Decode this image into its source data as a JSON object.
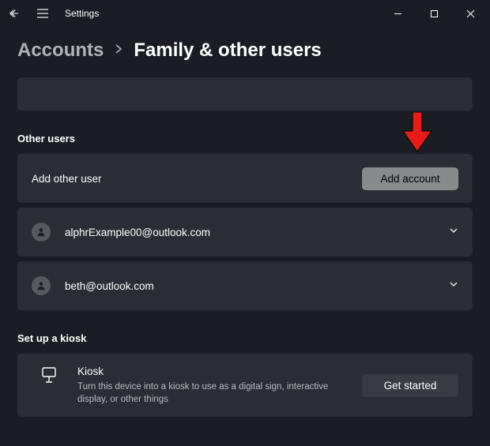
{
  "titlebar": {
    "label": "Settings"
  },
  "breadcrumb": {
    "parent": "Accounts",
    "current": "Family & other users"
  },
  "otherUsers": {
    "heading": "Other users",
    "addRow": {
      "label": "Add other user",
      "button": "Add account"
    },
    "users": [
      {
        "email": "alphrExample00@outlook.com"
      },
      {
        "email": "beth@outlook.com"
      }
    ]
  },
  "kiosk": {
    "heading": "Set up a kiosk",
    "title": "Kiosk",
    "description": "Turn this device into a kiosk to use as a digital sign, interactive display, or other things",
    "button": "Get started"
  }
}
